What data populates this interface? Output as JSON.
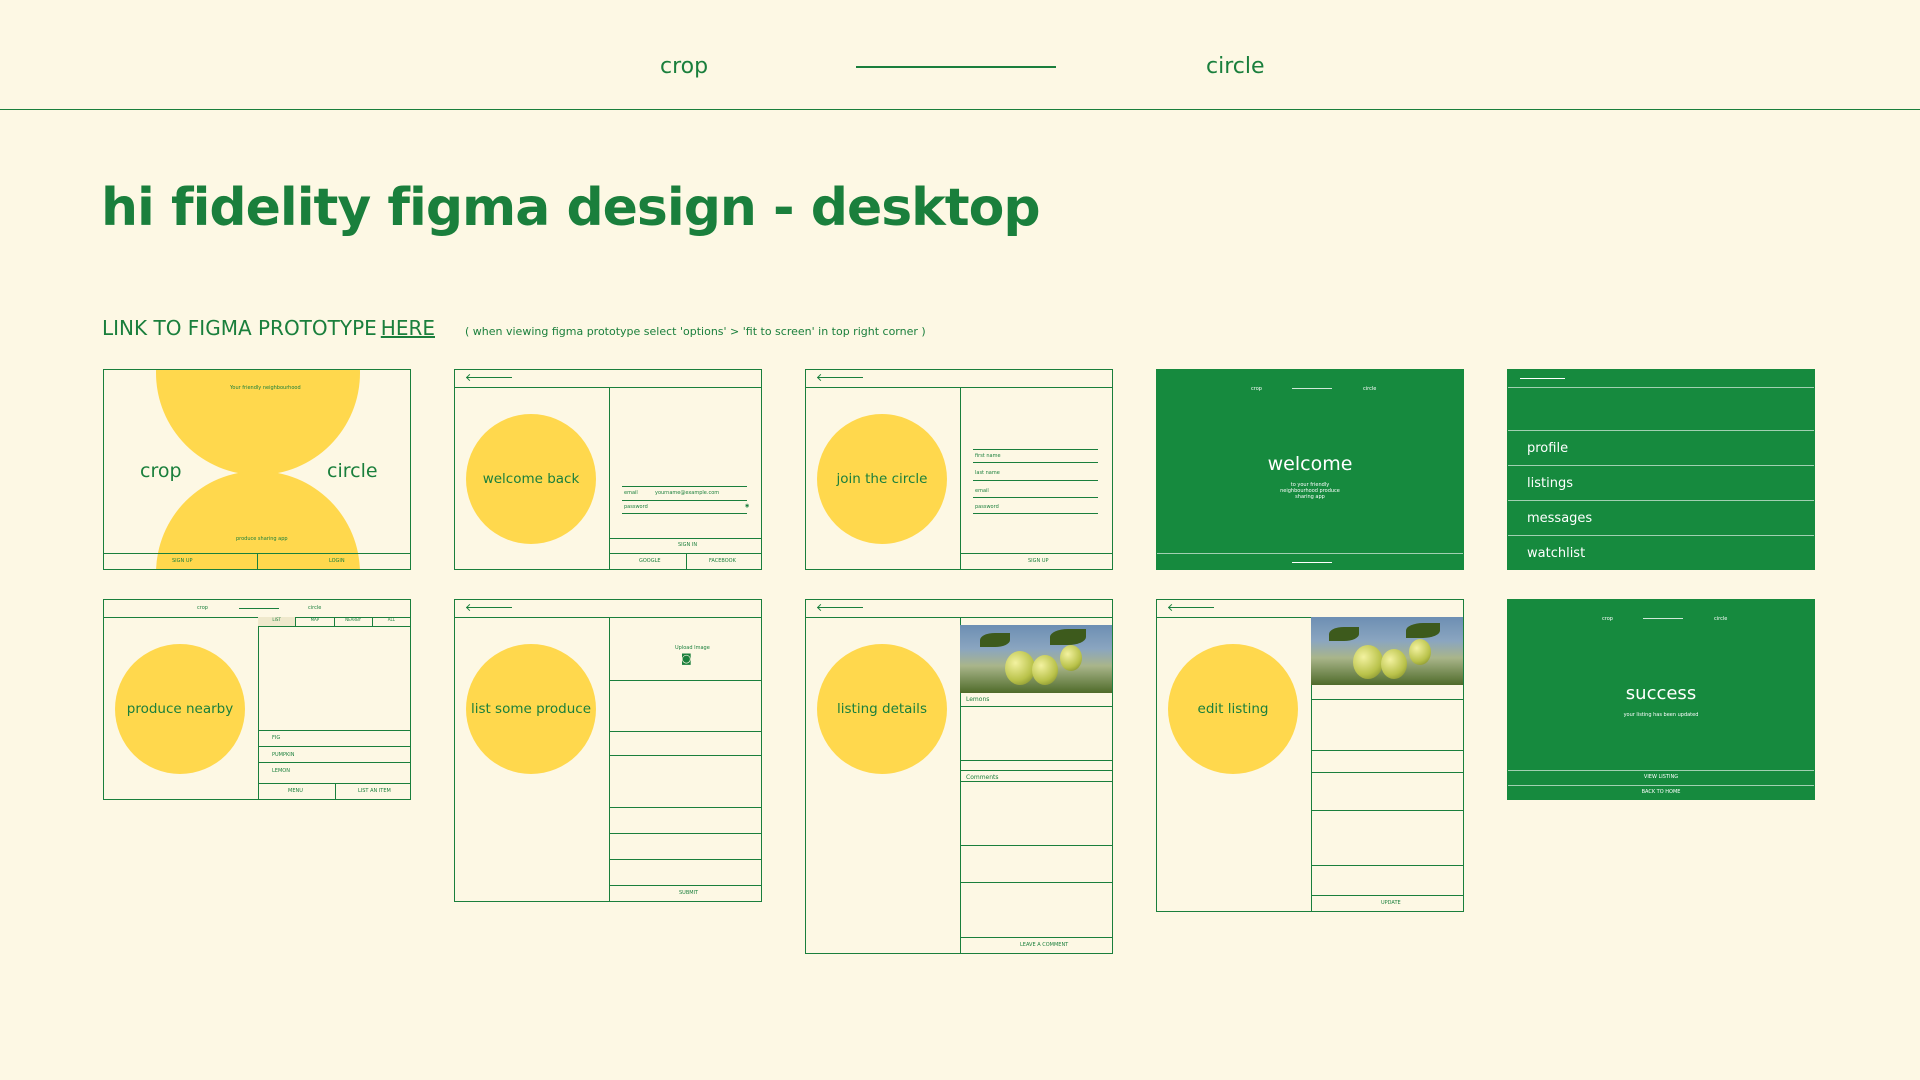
{
  "header": {
    "brand_left": "crop",
    "brand_right": "circle"
  },
  "page": {
    "title": "hi fidelity figma design - desktop",
    "link_label": "LINK TO FIGMA PROTOTYPE",
    "link_text": "HERE",
    "link_note": "( when viewing figma prototype select 'options' > 'fit to screen' in top right corner )"
  },
  "cards": {
    "landing": {
      "tagline": "Your friendly neighbourhood",
      "word_left": "crop",
      "word_right": "circle",
      "subtitle": "produce sharing app",
      "btn_left": "SIGN UP",
      "btn_right": "LOGIN"
    },
    "login": {
      "circle": "welcome back",
      "email_label": "email",
      "email_value": "yourname@example.com",
      "password_label": "password",
      "btn": "SIGN IN",
      "btn_left": "GOOGLE",
      "btn_right": "FACEBOOK"
    },
    "signup": {
      "circle": "join the circle",
      "fields": [
        "first name",
        "last name",
        "email",
        "password"
      ],
      "btn": "SIGN UP"
    },
    "welcome": {
      "brand_left": "crop",
      "brand_right": "circle",
      "title": "welcome",
      "subtitle": "to your friendly neighbourhood produce sharing app"
    },
    "menu": {
      "items": [
        "profile",
        "listings",
        "messages",
        "watchlist"
      ]
    },
    "produce": {
      "brand_left": "crop",
      "brand_right": "circle",
      "circle": "produce nearby",
      "tabs": [
        "LIST",
        "MAP",
        "NEARBY",
        "ALL"
      ],
      "rows": [
        "FIG",
        "PUMPKIN",
        "LEMON"
      ],
      "btn_left": "MENU",
      "btn_right": "LIST AN ITEM"
    },
    "list": {
      "circle": "list some produce",
      "upload": "Upload Image",
      "btn": "SUBMIT"
    },
    "details": {
      "circle": "listing details",
      "item": "Lemons",
      "comments": "Comments",
      "btn": "LEAVE A COMMENT"
    },
    "edit": {
      "circle": "edit listing",
      "btn": "UPDATE"
    },
    "success": {
      "brand_left": "crop",
      "brand_right": "circle",
      "title": "success",
      "subtitle": "your listing has been updated",
      "btn_top": "VIEW LISTING",
      "btn_bottom": "BACK TO HOME"
    }
  },
  "colors": {
    "background": "#fdf8e4",
    "green": "#1a7f3c",
    "yellow": "#ffd84d"
  }
}
